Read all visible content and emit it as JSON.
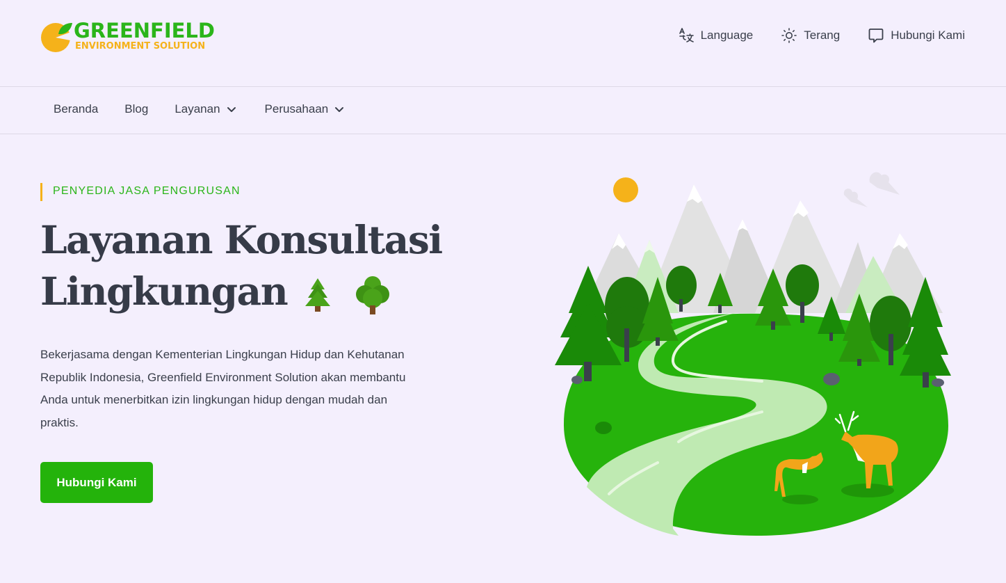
{
  "brand": {
    "name": "GREENFIELD",
    "tagline": "ENVIRONMENT SOLUTION",
    "colors": {
      "green": "#2bb51a",
      "yellow": "#f5b21a"
    }
  },
  "header": {
    "actions": [
      {
        "label": "Language",
        "icon": "translate-icon"
      },
      {
        "label": "Terang",
        "icon": "sun-icon"
      },
      {
        "label": "Hubungi Kami",
        "icon": "chat-bubble-icon"
      }
    ]
  },
  "nav": {
    "items": [
      {
        "label": "Beranda"
      },
      {
        "label": "Blog"
      },
      {
        "label": "Layanan",
        "icon": "chevron-down-icon"
      },
      {
        "label": "Perusahaan",
        "icon": "chevron-down-icon"
      }
    ]
  },
  "hero": {
    "eyebrow": "PENYEDIA JASA PENGURUSAN",
    "title_line1": "Layanan Konsultasi",
    "title_line2": "Lingkungan",
    "title_icons": [
      "pine-tree-icon",
      "deciduous-tree-icon"
    ],
    "description": "Bekerjasama dengan Kementerian Lingkungan Hidup dan Kehutanan Republik Indonesia, Greenfield Environment Solution akan membantu Anda untuk menerbitkan izin lingkungan hidup dengan mudah dan praktis.",
    "cta_label": "Hubungi Kami",
    "accent": "#24b30b"
  }
}
